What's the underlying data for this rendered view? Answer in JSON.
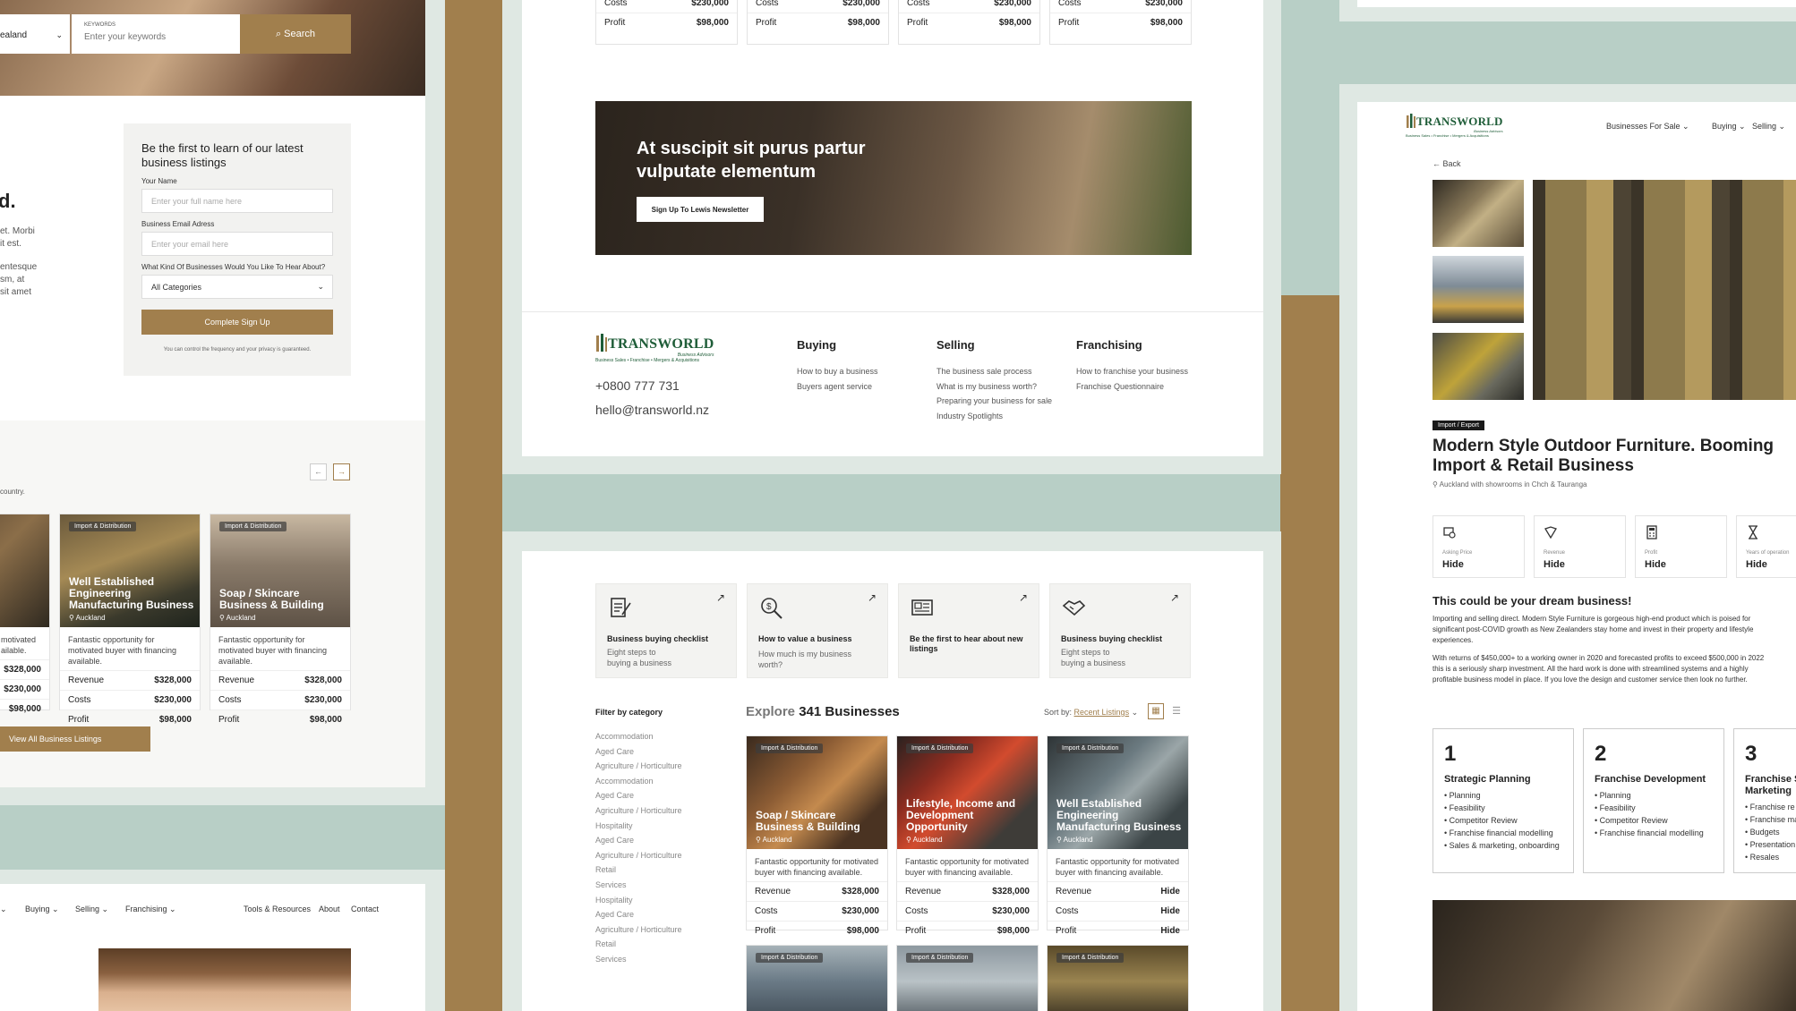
{
  "colors": {
    "background": "#b8cfc6",
    "accent": "#a17f4d",
    "white": "#ffffff",
    "text": "#222222"
  },
  "left_panel": {
    "search": {
      "location_value": "ealand",
      "keywords_label": "KEYWORDS",
      "keywords_placeholder": "Enter your keywords",
      "button": "Search"
    },
    "fragments": {
      "heading_tail": "d.",
      "body_lines": [
        "et. Morbi",
        "it est.",
        "entesque",
        "sm, at",
        "sit amet"
      ],
      "country": "country."
    },
    "signup": {
      "title": "Be the first to learn of our latest business listings",
      "name_label": "Your Name",
      "name_placeholder": "Enter your full name here",
      "email_label": "Business Email Adress",
      "email_placeholder": "Enter your email here",
      "interest_label": "What Kind Of Businesses Would You Like To Hear About?",
      "interest_value": "All Categories",
      "submit": "Complete Sign Up",
      "note": "You can control the frequency and your privacy is guaranteed."
    },
    "cards": [
      {
        "desc": "motivated ailable.",
        "rows": [
          {
            "label": "",
            "value": "$328,000"
          },
          {
            "label": "",
            "value": "$230,000"
          },
          {
            "label": "",
            "value": "$98,000"
          }
        ]
      },
      {
        "tag": "Import & Distribution",
        "title": "Well Established Engineering Manufacturing Business",
        "location": "Auckland",
        "desc": "Fantastic opportunity for motivated buyer with financing available.",
        "rows": [
          {
            "label": "Revenue",
            "value": "$328,000"
          },
          {
            "label": "Costs",
            "value": "$230,000"
          },
          {
            "label": "Profit",
            "value": "$98,000"
          }
        ]
      },
      {
        "tag": "Import & Distribution",
        "title": "Soap / Skincare Business & Building",
        "location": "Auckland",
        "desc": "Fantastic opportunity for motivated buyer with financing available.",
        "rows": [
          {
            "label": "Revenue",
            "value": "$328,000"
          },
          {
            "label": "Costs",
            "value": "$230,000"
          },
          {
            "label": "Profit",
            "value": "$98,000"
          }
        ]
      }
    ],
    "view_all": "View All Business Listings",
    "nav": {
      "items": [
        "Buying",
        "Selling",
        "Franchising"
      ],
      "right": [
        "Tools & Resources",
        "About",
        "Contact"
      ]
    }
  },
  "middle_top": {
    "row_labels": [
      "Revenue",
      "Costs",
      "Profit"
    ],
    "row_values": [
      "$328,000",
      "$230,000",
      "$98,000"
    ],
    "banner": {
      "title": "At suscipit sit purus partur vulputate elementum",
      "button": "Sign Up To Lewis Newsletter"
    },
    "footer": {
      "logo": "TRANSWORLD",
      "logo_sub": "Business Advisors",
      "logo_tag": "Business Sales • Franchise • Mergers & Acquisitions",
      "phone": "+0800 777 731",
      "email": "hello@transworld.nz",
      "buying": {
        "title": "Buying",
        "links": [
          "How to buy a business",
          "Buyers agent service"
        ]
      },
      "selling": {
        "title": "Selling",
        "links": [
          "The business sale process",
          "What is my business worth?",
          "Preparing your business for sale",
          "Industry Spotlights"
        ]
      },
      "franchising": {
        "title": "Franchising",
        "links": [
          "How to franchise your business",
          "Franchise Questionnaire"
        ]
      }
    }
  },
  "middle_bottom": {
    "resources": [
      {
        "title": "Business buying checklist",
        "desc": "Eight steps to buying a business",
        "icon": "checklist-icon"
      },
      {
        "title": "How to value a business",
        "desc": "How much is my business worth?",
        "icon": "magnifier-dollar-icon"
      },
      {
        "title": "Be the first to hear about new listings",
        "desc": "",
        "icon": "newspaper-icon"
      },
      {
        "title": "Business buying checklist",
        "desc": "Eight steps to buying a business",
        "icon": "handshake-icon"
      }
    ],
    "filter_title": "Filter by category",
    "categories": [
      "Accommodation",
      "Aged Care",
      "Agriculture / Horticulture",
      "Accommodation",
      "Aged Care",
      "Agriculture / Horticulture",
      "Hospitality",
      "Aged Care",
      "Agriculture / Horticulture",
      "Retail",
      "Services",
      "Hospitality",
      "Aged Care",
      "Agriculture / Horticulture",
      "Retail",
      "Services"
    ],
    "explore_prefix": "Explore",
    "explore_count": "341 Businesses",
    "sort_label": "Sort by:",
    "sort_value": "Recent Listings",
    "cards": [
      {
        "tag": "Import & Distribution",
        "title": "Soap / Skincare Business & Building",
        "location": "Auckland",
        "desc": "Fantastic opportunity for motivated buyer with financing available.",
        "rows": [
          {
            "label": "Revenue",
            "value": "$328,000"
          },
          {
            "label": "Costs",
            "value": "$230,000"
          },
          {
            "label": "Profit",
            "value": "$98,000"
          }
        ]
      },
      {
        "tag": "Import & Distribution",
        "title": "Lifestyle, Income and Development Opportunity",
        "location": "Auckland",
        "desc": "Fantastic opportunity for motivated buyer with financing available.",
        "rows": [
          {
            "label": "Revenue",
            "value": "$328,000"
          },
          {
            "label": "Costs",
            "value": "$230,000"
          },
          {
            "label": "Profit",
            "value": "$98,000"
          }
        ]
      },
      {
        "tag": "Import & Distribution",
        "title": "Well Established Engineering Manufacturing Business",
        "location": "Auckland",
        "desc": "Fantastic opportunity for motivated buyer with financing available.",
        "rows": [
          {
            "label": "Revenue",
            "value": "Hide"
          },
          {
            "label": "Costs",
            "value": "Hide"
          },
          {
            "label": "Profit",
            "value": "Hide"
          }
        ]
      }
    ],
    "more_tags": [
      "Import & Distribution",
      "Import & Distribution",
      "Import & Distribution"
    ]
  },
  "right_panel": {
    "nav": {
      "logo": "TRANSWORLD",
      "logo_sub": "Business Advisors",
      "logo_tag": "Business Sales • Franchise • Mergers & Acquisitions",
      "items": [
        "Businesses For Sale",
        "Buying",
        "Selling"
      ]
    },
    "back": "Back",
    "tag": "Import / Export",
    "title": "Modern Style Outdoor Furniture. Booming Import & Retail Business",
    "location": "Auckland with showrooms in Chch & Tauranga",
    "stats": [
      {
        "label": "Asking Price",
        "value": "Hide",
        "icon": "price-tag-icon"
      },
      {
        "label": "Revenue",
        "value": "Hide",
        "icon": "revenue-icon"
      },
      {
        "label": "Profit",
        "value": "Hide",
        "icon": "calculator-icon"
      },
      {
        "label": "Years of operation",
        "value": "Hide",
        "icon": "hourglass-icon"
      }
    ],
    "dream_title": "This could be your dream business!",
    "para1": "Importing and selling direct. Modern Style Furniture is gorgeous high-end product which is poised for significant post-COVID growth as New Zealanders stay home and invest in their property and lifestyle experiences.",
    "para2": "With returns of $450,000+ to a working owner in 2020 and forecasted profits to exceed $500,000 in 2022 this is a seriously sharp investment. All the hard work is done with streamlined systems and a highly profitable business model in place. If you love the design and customer service then look no further.",
    "steps": [
      {
        "n": "1",
        "title": "Strategic Planning",
        "items": [
          "Planning",
          "Feasibility",
          "Competitor Review",
          "Franchise financial modelling",
          "Sales & marketing, onboarding"
        ]
      },
      {
        "n": "2",
        "title": "Franchise Development",
        "items": [
          "Planning",
          "Feasibility",
          "Competitor Review",
          "Franchise financial modelling"
        ]
      },
      {
        "n": "3",
        "title": "Franchise S Marketing",
        "items": [
          "Franchise re",
          "Franchise ma",
          "Budgets",
          "Presentation",
          "Resales"
        ]
      }
    ]
  }
}
